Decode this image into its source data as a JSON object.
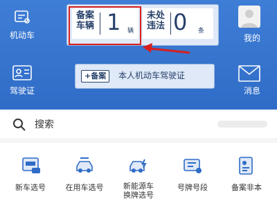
{
  "sidebar_left": {
    "items": [
      {
        "label": "机动车",
        "icon": "car-icon"
      },
      {
        "label": "驾驶证",
        "icon": "id-card-icon"
      }
    ]
  },
  "sidebar_right": {
    "items": [
      {
        "label": "我的",
        "icon": "avatar-icon"
      },
      {
        "label": "消息",
        "icon": "mail-icon"
      }
    ]
  },
  "stats": {
    "registered": {
      "label_line1": "备案",
      "label_line2": "车辆",
      "value": "1",
      "unit": "辆"
    },
    "violations": {
      "label_line1": "未处",
      "label_line2": "违法",
      "value": "0",
      "unit": "条"
    }
  },
  "license_bar": {
    "tag": "+备案",
    "text": "本人机动车驾驶证"
  },
  "search": {
    "label": "搜索",
    "icon": "search-icon"
  },
  "services": [
    {
      "label": "新车选号",
      "icon": "new-plate-icon"
    },
    {
      "label": "在用车选号",
      "icon": "used-car-icon"
    },
    {
      "label": "新能源车\n换牌选号",
      "icon": "ev-car-icon"
    },
    {
      "label": "号牌号段",
      "icon": "plate-range-icon"
    },
    {
      "label": "备案非本",
      "icon": "document-icon"
    }
  ],
  "colors": {
    "primary": "#2f6cc7",
    "highlight": "#d81e1e",
    "text_dark": "#27406a"
  },
  "annotation": {
    "type": "red-arrow"
  }
}
